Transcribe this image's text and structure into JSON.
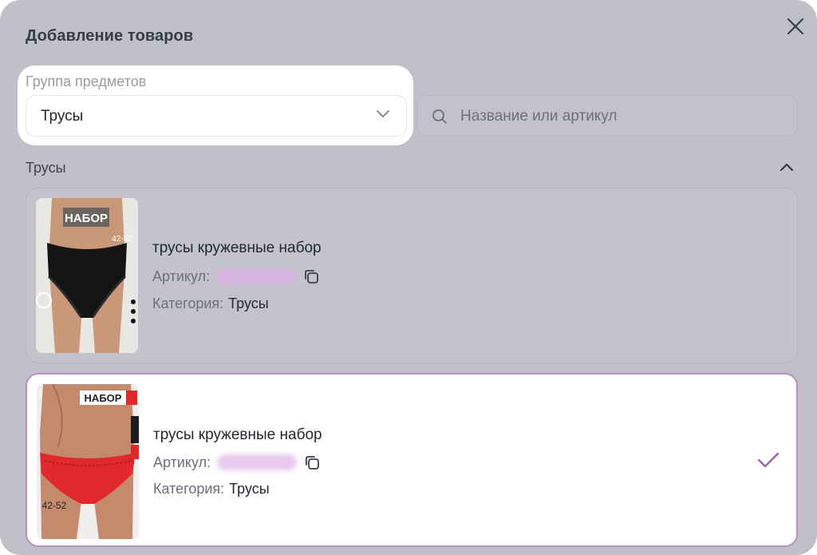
{
  "modal": {
    "title": "Добавление товаров",
    "close_icon": "close-icon"
  },
  "filters": {
    "group_label": "Группа предметов",
    "group_selected": "Трусы",
    "search_placeholder": "Название или артикул"
  },
  "section": {
    "title": "Трусы",
    "expanded": true
  },
  "products": [
    {
      "title": "трусы кружевные набор",
      "article_label": "Артикул:",
      "category_label": "Категория:",
      "category_value": "Трусы",
      "image_caption": "НАБОР",
      "image_size": "42-52",
      "selected": false
    },
    {
      "title": "трусы кружевные набор",
      "article_label": "Артикул:",
      "category_label": "Категория:",
      "category_value": "Трусы",
      "image_caption": "НАБОР",
      "image_size": "42-52",
      "selected": true
    }
  ],
  "colors": {
    "overlay": "#c0c1c8",
    "accent": "#9b5fb5",
    "selected_border": "#b88fc9"
  }
}
